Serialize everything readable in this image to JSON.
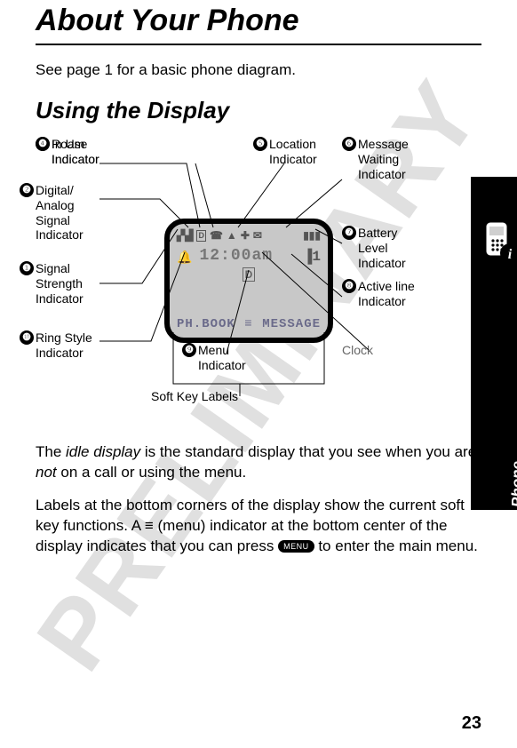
{
  "watermark": "PRELIMINARY",
  "title": "About Your Phone",
  "intro": "See page 1 for a basic phone diagram.",
  "subheading": "Using the Display",
  "sideTab": "About Your Phone",
  "pageNumber": "23",
  "labels": {
    "n1": "Signal Strength Indicator",
    "n2": "Digital/\nAnalog Signal Indicator",
    "n3": "In Use Indicator",
    "n4": "Roam Indicator",
    "n5": "Location Indicator",
    "n6": "Message Waiting Indicator",
    "n7": "Battery Level Indicator",
    "n8": "Active line Indicator",
    "n9": "Menu Indicator",
    "n10": "Ring Style Indicator",
    "clock": "Clock",
    "softkeys": "Soft Key Labels"
  },
  "display": {
    "clock": "12:00am",
    "line": "▐1",
    "menuIndicator": "D",
    "softkeyLeft": "PH.BOOK",
    "softkeyRight": "MESSAGE",
    "menuGlyph": "≡"
  },
  "body": {
    "p1_a": "The ",
    "p1_i": "idle display",
    "p1_b": " is the standard display that you see when you are ",
    "p1_i2": "not",
    "p1_c": " on a call or using the menu.",
    "p2_a": "Labels at the bottom corners of the display show the current soft key functions. A ",
    "p2_glyph": "≡",
    "p2_b": " (menu) indicator at the bottom center of the display indicates that you can press ",
    "p2_key": "MENU",
    "p2_c": " to enter the main menu."
  }
}
